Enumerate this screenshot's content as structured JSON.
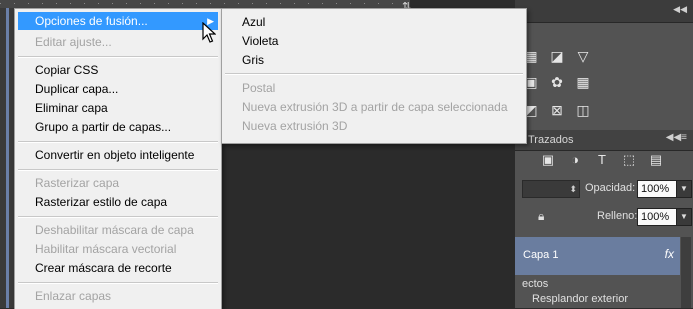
{
  "context_menu": {
    "items": [
      {
        "label": "Opciones de fusión...",
        "enabled": true,
        "highlighted": true
      },
      {
        "label": "Editar ajuste...",
        "enabled": false
      },
      {
        "label": "Copiar CSS",
        "enabled": true
      },
      {
        "label": "Duplicar capa...",
        "enabled": true
      },
      {
        "label": "Eliminar capa",
        "enabled": true
      },
      {
        "label": "Grupo a partir de capas...",
        "enabled": true
      },
      {
        "label": "Convertir en objeto inteligente",
        "enabled": true
      },
      {
        "label": "Rasterizar capa",
        "enabled": false
      },
      {
        "label": "Rasterizar estilo de capa",
        "enabled": true
      },
      {
        "label": "Deshabilitar máscara de capa",
        "enabled": false
      },
      {
        "label": "Habilitar máscara vectorial",
        "enabled": false
      },
      {
        "label": "Crear máscara de recorte",
        "enabled": true
      },
      {
        "label": "Enlazar capas",
        "enabled": false
      }
    ]
  },
  "submenu": {
    "items": [
      {
        "label": "Azul",
        "enabled": true
      },
      {
        "label": "Violeta",
        "enabled": true
      },
      {
        "label": "Gris",
        "enabled": true
      },
      {
        "label": "Postal",
        "enabled": false
      },
      {
        "label": "Nueva extrusión 3D a partir de capa seleccionada",
        "enabled": false
      },
      {
        "label": "Nueva extrusión 3D",
        "enabled": false
      }
    ]
  },
  "layers_panel": {
    "tab_label": "Trazados",
    "opacity_label": "Opacidad:",
    "opacity_value": "100%",
    "fill_label": "Relleno:",
    "fill_value": "100%",
    "layer_name": "Capa 1",
    "fx_badge": "fx",
    "effects_label": "ectos",
    "effect_item": "Resplandor exterior"
  },
  "colors": {
    "menu_highlight": "#3399ff",
    "selected_layer": "#6a7d9f",
    "disabled_text": "#a3a3a3"
  }
}
